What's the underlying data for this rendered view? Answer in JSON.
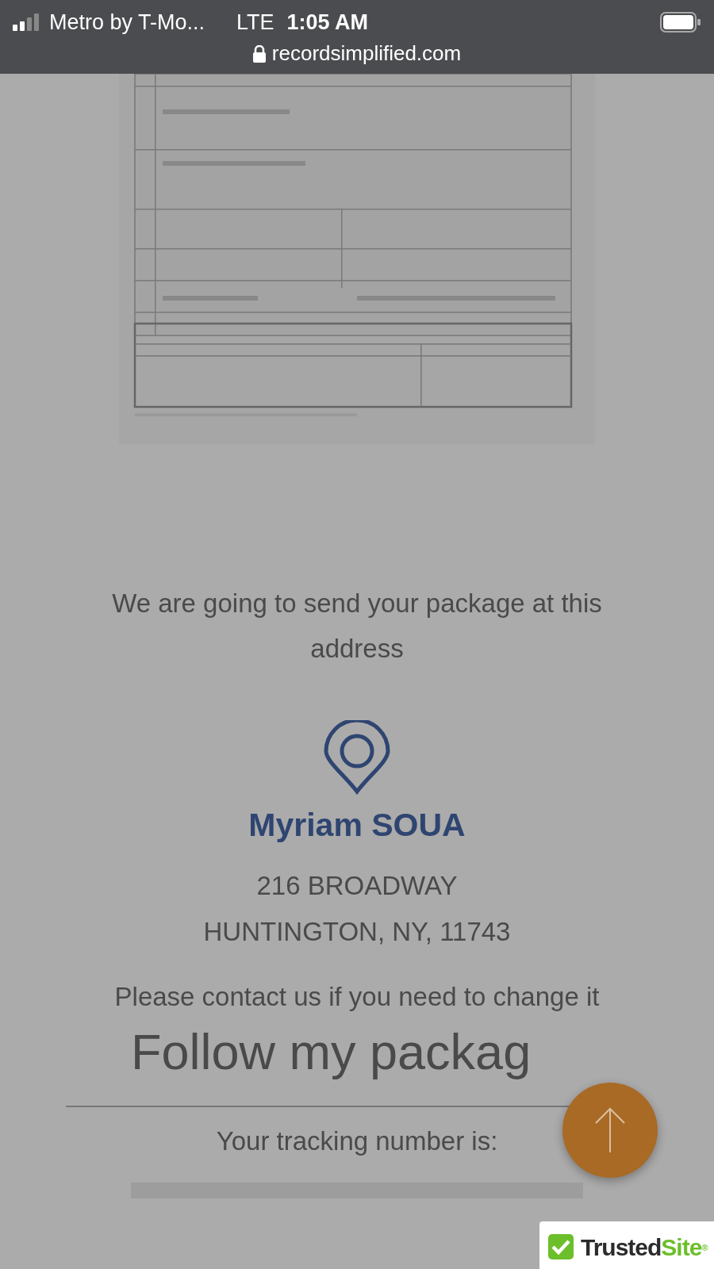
{
  "status_bar": {
    "carrier": "Metro by T-Mo...",
    "network": "LTE",
    "time": "1:05 AM",
    "url": "recordsimplified.com"
  },
  "intro": "We are going to send your package at this address",
  "recipient": {
    "name": "Myriam SOUA",
    "address_lines": [
      "216 BROADWAY",
      "HUNTINGTON, NY, 11743"
    ]
  },
  "contact_note": "Please contact us if you need to change it",
  "tracking": {
    "heading": "Follow my packag",
    "label": "Your tracking number is:"
  },
  "trust_badge": {
    "word_1": "Trusted",
    "word_2": "Site",
    "mark": "®"
  }
}
